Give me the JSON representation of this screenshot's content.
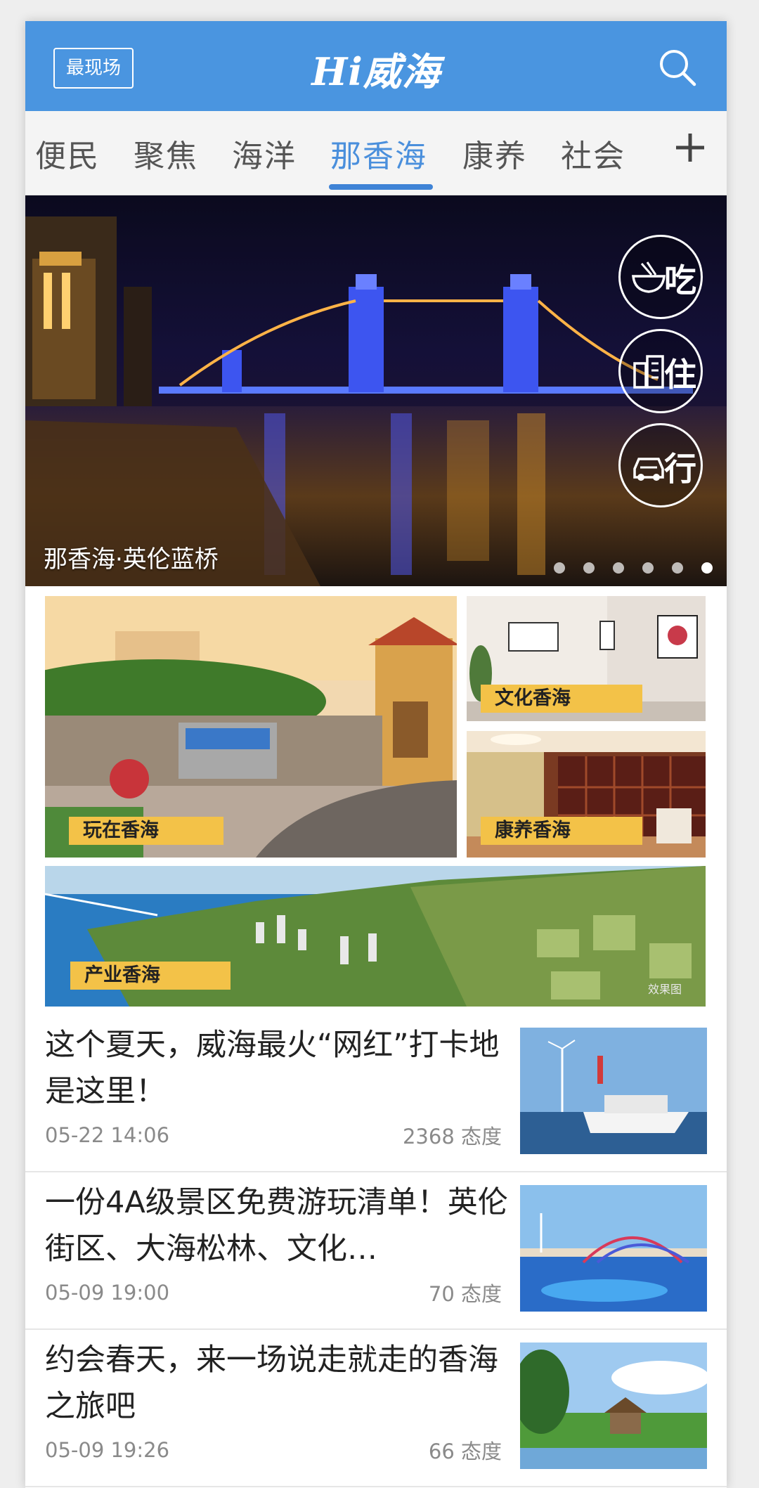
{
  "header": {
    "live_badge": "最现场",
    "brand_title": "Hi威海"
  },
  "tabs": [
    {
      "label": "便民"
    },
    {
      "label": "聚焦"
    },
    {
      "label": "海洋"
    },
    {
      "label": "那香海",
      "active": true
    },
    {
      "label": "康养"
    },
    {
      "label": "社会"
    }
  ],
  "hero": {
    "caption": "那香海·英伦蓝桥",
    "slide_count": 6,
    "active_slide": 6,
    "quick_actions": [
      {
        "label": "吃",
        "icon": "bowl-icon"
      },
      {
        "label": "住",
        "icon": "building-icon"
      },
      {
        "label": "行",
        "icon": "car-icon"
      }
    ]
  },
  "grid": {
    "play": "玩在香海",
    "culture": "文化香海",
    "health": "康养香海",
    "industry": "产业香海",
    "watermark": "效果图"
  },
  "news": [
    {
      "title": "这个夏天，威海最火“网红”打卡地是这里！",
      "date": "05-22 14:06",
      "count": "2368 态度"
    },
    {
      "title": "一份4A级景区免费游玩清单！英伦街区、大海松林、文化…",
      "date": "05-09 19:00",
      "count": "70 态度"
    },
    {
      "title": "约会春天，来一场说走就走的香海之旅吧",
      "date": "05-09 19:26",
      "count": "66 态度"
    }
  ],
  "colors": {
    "header_blue": "#4a95e0",
    "tab_active": "#4a8fdc",
    "label_yellow": "#f3c248"
  }
}
